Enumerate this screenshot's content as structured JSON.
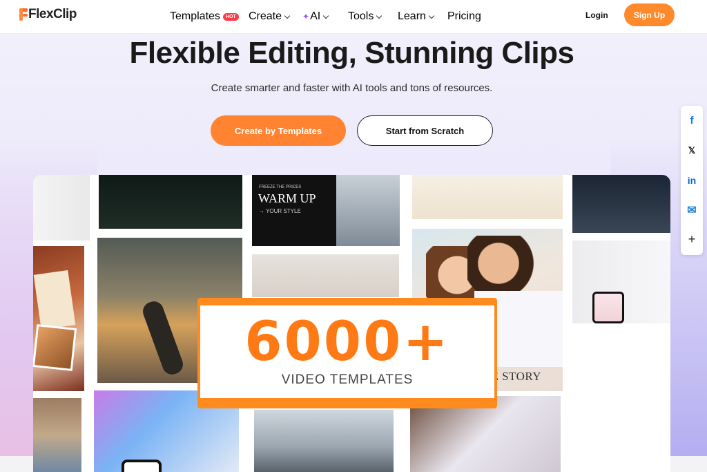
{
  "header": {
    "logo_text": "FlexClip",
    "nav": [
      {
        "label": "Templates",
        "badge": "HOT",
        "dropdown": false
      },
      {
        "label": "Create",
        "dropdown": true
      },
      {
        "label": "AI",
        "icon": "sparkle-icon",
        "dropdown": true
      },
      {
        "label": "Tools",
        "dropdown": true
      },
      {
        "label": "Learn",
        "dropdown": true
      },
      {
        "label": "Pricing",
        "dropdown": false
      }
    ],
    "login_label": "Login",
    "signup_label": "Sign Up"
  },
  "hero": {
    "headline": "Flexible Editing, Stunning Clips",
    "subheadline": "Create smarter and faster with AI tools and tons of resources.",
    "primary_button": "Create by Templates",
    "secondary_button": "Start from Scratch"
  },
  "social": [
    {
      "icon": "facebook-icon",
      "glyph": "f",
      "color": "#1877f2"
    },
    {
      "icon": "x-icon",
      "glyph": "𝕏",
      "color": "#111111"
    },
    {
      "icon": "linkedin-icon",
      "glyph": "in",
      "color": "#0a66c2"
    },
    {
      "icon": "mail-icon",
      "glyph": "✉",
      "color": "#1d7fe0"
    },
    {
      "icon": "plus-icon",
      "glyph": "+",
      "color": "#222222"
    }
  ],
  "collage": {
    "banner_count": "6000+",
    "banner_caption": "VIDEO TEMPLATES",
    "warm_small": "FREEZE THE PRICES",
    "warm_title": "WARM UP",
    "warm_sub": "→ YOUR STYLE",
    "love_story": "LOVE STORY"
  },
  "colors": {
    "accent": "#ff8330",
    "text": "#1a1a1a"
  }
}
